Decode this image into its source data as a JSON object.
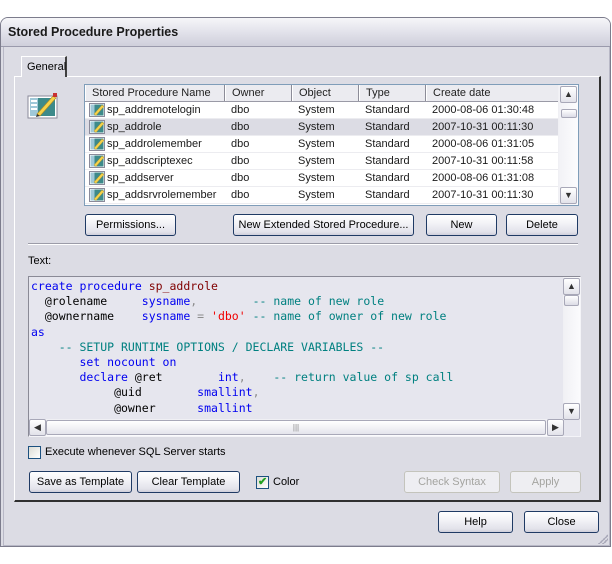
{
  "window": {
    "title": "Stored Procedure Properties"
  },
  "tabs": [
    {
      "label": "General",
      "active": true
    }
  ],
  "procedures": {
    "columns": [
      "Stored Procedure Name",
      "Owner",
      "Object",
      "Type",
      "Create date"
    ],
    "rows": [
      {
        "name": "sp_addremotelogin",
        "owner": "dbo",
        "object": "System",
        "type": "Standard",
        "created": "2000-08-06 01:30:48"
      },
      {
        "name": "sp_addrole",
        "owner": "dbo",
        "object": "System",
        "type": "Standard",
        "created": "2007-10-31 00:11:30"
      },
      {
        "name": "sp_addrolemember",
        "owner": "dbo",
        "object": "System",
        "type": "Standard",
        "created": "2000-08-06 01:31:05"
      },
      {
        "name": "sp_addscriptexec",
        "owner": "dbo",
        "object": "System",
        "type": "Standard",
        "created": "2007-10-31 00:11:58"
      },
      {
        "name": "sp_addserver",
        "owner": "dbo",
        "object": "System",
        "type": "Standard",
        "created": "2000-08-06 01:31:08"
      },
      {
        "name": "sp_addsrvrolemember",
        "owner": "dbo",
        "object": "System",
        "type": "Standard",
        "created": "2007-10-31 00:11:30"
      }
    ],
    "selected_index": 1
  },
  "list_buttons": {
    "permissions": "Permissions...",
    "new_extended": "New Extended Stored Procedure...",
    "new": "New",
    "delete": "Delete"
  },
  "text_label": "Text:",
  "code": {
    "lines": [
      [
        {
          "t": "create procedure ",
          "k": "kw"
        },
        {
          "t": "sp_addrole",
          "k": "proc"
        }
      ],
      [
        {
          "t": "  @rolename     ",
          "k": "var"
        },
        {
          "t": "sysname",
          "k": "kw"
        },
        {
          "t": ",",
          "k": "punct"
        },
        {
          "t": "        -- name of new role",
          "k": "comment"
        }
      ],
      [
        {
          "t": "  @ownername    ",
          "k": "var"
        },
        {
          "t": "sysname ",
          "k": "kw"
        },
        {
          "t": "= ",
          "k": "punct"
        },
        {
          "t": "'dbo'",
          "k": "str"
        },
        {
          "t": " -- name of owner of new role",
          "k": "comment"
        }
      ],
      [
        {
          "t": "as",
          "k": "kw"
        }
      ],
      [
        {
          "t": "    -- SETUP RUNTIME OPTIONS / DECLARE VARIABLES --",
          "k": "comment"
        }
      ],
      [
        {
          "t": "       set nocount on",
          "k": "kw"
        }
      ],
      [
        {
          "t": "       declare ",
          "k": "kw"
        },
        {
          "t": "@ret        ",
          "k": "var"
        },
        {
          "t": "int",
          "k": "kw"
        },
        {
          "t": ",",
          "k": "punct"
        },
        {
          "t": "    -- return value of sp call",
          "k": "comment"
        }
      ],
      [
        {
          "t": "            @uid        ",
          "k": "var"
        },
        {
          "t": "smallint",
          "k": "kw"
        },
        {
          "t": ",",
          "k": "punct"
        }
      ],
      [
        {
          "t": "            @owner      ",
          "k": "var"
        },
        {
          "t": "smallint",
          "k": "kw"
        }
      ]
    ]
  },
  "options": {
    "execute_on_startup": {
      "label": "Execute whenever SQL Server starts",
      "checked": false
    },
    "color": {
      "label": "Color",
      "checked": true
    }
  },
  "template_buttons": {
    "save_template": "Save as Template",
    "clear_template": "Clear Template",
    "check_syntax": "Check Syntax",
    "apply": "Apply"
  },
  "footer": {
    "help": "Help",
    "close": "Close"
  },
  "icons": {
    "window_icon": "stored-procedure-icon",
    "row_icon": "stored-procedure-icon",
    "scroll_up": "▲",
    "scroll_down": "▼",
    "scroll_left": "◀",
    "scroll_right": "▶",
    "check": "✔"
  }
}
